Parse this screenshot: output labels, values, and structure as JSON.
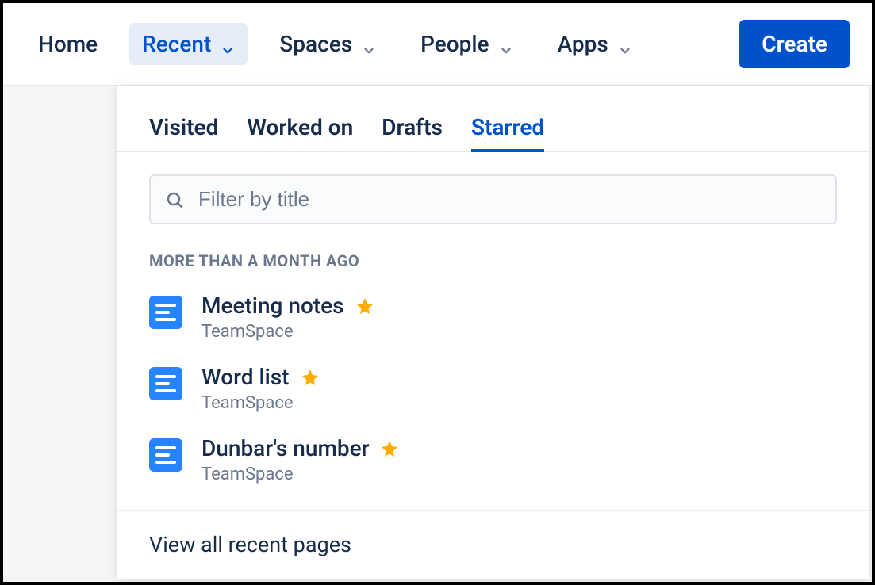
{
  "nav": {
    "home": "Home",
    "recent": "Recent",
    "spaces": "Spaces",
    "people": "People",
    "apps": "Apps",
    "create": "Create"
  },
  "dropdown": {
    "tabs": {
      "visited": "Visited",
      "worked_on": "Worked on",
      "drafts": "Drafts",
      "starred": "Starred"
    },
    "filter_placeholder": "Filter by title",
    "section_heading": "More than a month ago",
    "items": [
      {
        "title": "Meeting notes",
        "space": "TeamSpace"
      },
      {
        "title": "Word list",
        "space": "TeamSpace"
      },
      {
        "title": "Dunbar's number",
        "space": "TeamSpace"
      }
    ],
    "view_all": "View all recent pages"
  },
  "colors": {
    "brand_blue": "#0052CC",
    "text_dark": "#172B4D",
    "text_muted": "#6B778C",
    "star": "#FFAB00",
    "page_icon": "#2684FF"
  }
}
